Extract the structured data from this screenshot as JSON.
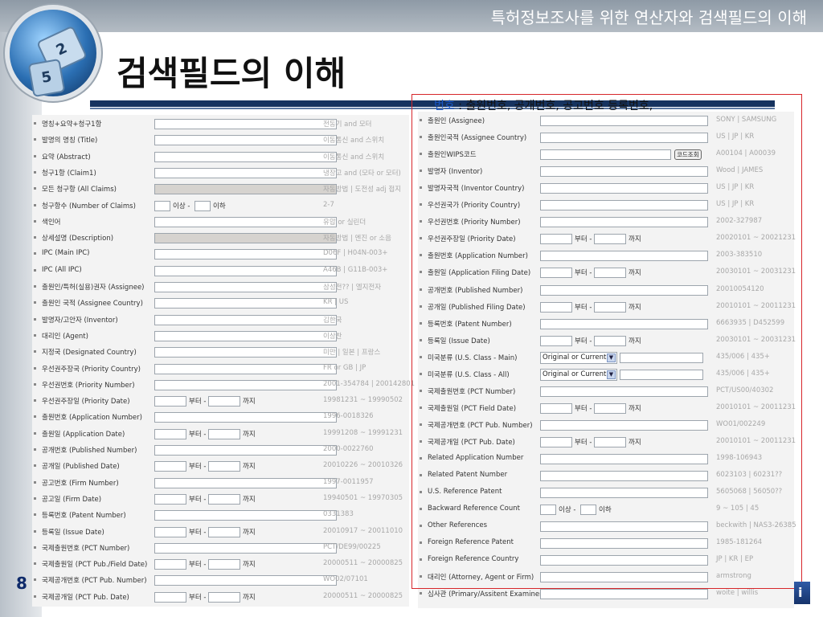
{
  "header": {
    "slide_title": "특허정보조사를 위한 연산자와 검색필드의 이해",
    "main_title": "검색필드의 이해",
    "page_number": "8",
    "logo_dice_1": "2",
    "logo_dice_2": "5"
  },
  "note": {
    "keyword": "번호",
    "text": " : 출원번호, 공개번호, 공고번호 등록번호,"
  },
  "labels": {
    "from": "부터 -",
    "to": "까지",
    "more": "이상 -",
    "less": "이하",
    "code_search": "코드조회",
    "select_value": "Original or Current"
  },
  "left_form": [
    {
      "label": "명칭+요약+청구1항",
      "example": "전동기 and 모터",
      "type": "text"
    },
    {
      "label": "발명의 명칭 (Title)",
      "example": "이동통신 and 스위치",
      "type": "text"
    },
    {
      "label": "요약 (Abstract)",
      "example": "이동통신 and 스위치",
      "type": "text"
    },
    {
      "label": "청구1항 (Claim1)",
      "example": "냉장고 and (모타 or 모터)",
      "type": "text"
    },
    {
      "label": "모든 청구항 (All Claims)",
      "example": "자동방법 | 도전성 adj 접지",
      "type": "disabled"
    },
    {
      "label": "청구항수 (Number of Claims)",
      "example": "2-7",
      "type": "count"
    },
    {
      "label": "색인어",
      "example": "유압 or 실린더",
      "type": "text"
    },
    {
      "label": "상세설명 (Description)",
      "example": "자동방법 | 엔진 or 소음",
      "type": "disabled"
    },
    {
      "label": "IPC (Main IPC)",
      "example": "D06F | H04N-003+",
      "type": "text"
    },
    {
      "label": "IPC (All IPC)",
      "example": "A46B | G11B-003+",
      "type": "text"
    },
    {
      "label": "출원인/특허(실용)권자 (Assignee)",
      "example": "삼성전?? | 엘지전자",
      "type": "text"
    },
    {
      "label": "출원인 국적 (Assignee Country)",
      "example": "KR | US",
      "type": "text"
    },
    {
      "label": "발명자/고안자 (Inventor)",
      "example": "김한국",
      "type": "text"
    },
    {
      "label": "대리인 (Agent)",
      "example": "이상찬",
      "type": "text"
    },
    {
      "label": "지정국 (Designated Country)",
      "example": "미만 | 일본 | 프랑스",
      "type": "text"
    },
    {
      "label": "우선권주장국 (Priority Country)",
      "example": "FR or GB | JP",
      "type": "text"
    },
    {
      "label": "우선권번호 (Priority Number)",
      "example": "2001-354784 | 200142801",
      "type": "text"
    },
    {
      "label": "우선권주장일 (Priority Date)",
      "example": "19981231 ~ 19990502",
      "type": "range"
    },
    {
      "label": "출원번호 (Application Number)",
      "example": "1996-0018326",
      "type": "text"
    },
    {
      "label": "출원일 (Application Date)",
      "example": "19991208 ~ 19991231",
      "type": "range"
    },
    {
      "label": "공개번호 (Published Number)",
      "example": "2000-0022760",
      "type": "text"
    },
    {
      "label": "공개일 (Published Date)",
      "example": "20010226 ~ 20010326",
      "type": "range"
    },
    {
      "label": "공고번호 (Firm Number)",
      "example": "1997-0011957",
      "type": "text"
    },
    {
      "label": "공고일 (Firm Date)",
      "example": "19940501 ~ 19970305",
      "type": "range"
    },
    {
      "label": "등록번호 (Patent Number)",
      "example": "0331383",
      "type": "text"
    },
    {
      "label": "등록일 (Issue Date)",
      "example": "20010917 ~ 20011010",
      "type": "range"
    },
    {
      "label": "국제출원번호 (PCT Number)",
      "example": "PCT/DE99/00225",
      "type": "text"
    },
    {
      "label": "국제출원일 (PCT Pub./Field Date)",
      "example": "20000511 ~ 20000825",
      "type": "range"
    },
    {
      "label": "국제공개번호 (PCT Pub. Number)",
      "example": "WO02/07101",
      "type": "text"
    },
    {
      "label": "국제공개일 (PCT Pub. Date)",
      "example": "20000511 ~ 20000825",
      "type": "range"
    }
  ],
  "right_form": [
    {
      "label": "출원인 (Assignee)",
      "example": "SONY | SAMSUNG",
      "type": "text"
    },
    {
      "label": "출원인국적 (Assignee Country)",
      "example": "US | JP | KR",
      "type": "text"
    },
    {
      "label": "출원인WIPS코드",
      "example": "A00104 | A00039",
      "type": "code"
    },
    {
      "label": "발명자 (Inventor)",
      "example": "Wood | JAMES",
      "type": "text"
    },
    {
      "label": "발명자국적 (Inventor Country)",
      "example": "US | JP | KR",
      "type": "text"
    },
    {
      "label": "우선권국가 (Priority Country)",
      "example": "US | JP | KR",
      "type": "text"
    },
    {
      "label": "우선권번호 (Priority Number)",
      "example": "2002-327987",
      "type": "text"
    },
    {
      "label": "우선권주장일 (Priority Date)",
      "example": "20020101 ~ 20021231",
      "type": "range"
    },
    {
      "label": "출원번호 (Application Number)",
      "example": "2003-383510",
      "type": "text"
    },
    {
      "label": "출원일 (Application Filing Date)",
      "example": "20030101 ~ 20031231",
      "type": "range"
    },
    {
      "label": "공개번호 (Published Number)",
      "example": "20010054120",
      "type": "text"
    },
    {
      "label": "공개일 (Published Filing Date)",
      "example": "20010101 ~ 20011231",
      "type": "range"
    },
    {
      "label": "등록번호 (Patent Number)",
      "example": "6663935 | D452599",
      "type": "text"
    },
    {
      "label": "등록일 (Issue Date)",
      "example": "20030101 ~ 20031231",
      "type": "range"
    },
    {
      "label": "미국분류 (U.S. Class - Main)",
      "example": "435/006 | 435+",
      "type": "select"
    },
    {
      "label": "미국분류 (U.S. Class - All)",
      "example": "435/006 | 435+",
      "type": "select"
    },
    {
      "label": "국제출원번호 (PCT Number)",
      "example": "PCT/US00/40302",
      "type": "text"
    },
    {
      "label": "국제출원일 (PCT Field Date)",
      "example": "20010101 ~ 20011231",
      "type": "range"
    },
    {
      "label": "국제공개번호 (PCT Pub. Number)",
      "example": "WO01/002249",
      "type": "text"
    },
    {
      "label": "국제공개일 (PCT Pub. Date)",
      "example": "20010101 ~ 20011231",
      "type": "range"
    },
    {
      "label": "Related Application Number",
      "example": "1998-106943",
      "type": "text"
    },
    {
      "label": "Related Patent Number",
      "example": "6023103 | 60231??",
      "type": "text"
    },
    {
      "label": "U.S. Reference Patent",
      "example": "5605068 | 56050??",
      "type": "text"
    },
    {
      "label": "Backward Reference Count",
      "example": "9 ~ 105 | 45",
      "type": "count"
    },
    {
      "label": "Other References",
      "example": "beckwith | NAS3-26385",
      "type": "text"
    },
    {
      "label": "Foreign Reference Patent",
      "example": "1985-181264",
      "type": "text"
    },
    {
      "label": "Foreign Reference Country",
      "example": "JP | KR | EP",
      "type": "text"
    },
    {
      "label": "대리인 (Attorney, Agent or Firm)",
      "example": "armstrong",
      "type": "text"
    },
    {
      "label": "심사관 (Primary/Assitent Examiner)",
      "example": "woite | willis",
      "type": "text"
    }
  ],
  "colors": {
    "title_bar": "#9aa5b0",
    "underline": "#16335f",
    "red_frame": "#d7262a",
    "keyword": "#1a57c8",
    "page_number": "#0e2a6a"
  },
  "icons": {
    "logo": "dice-globe-logo",
    "dropdown": "chevron-down-icon"
  }
}
